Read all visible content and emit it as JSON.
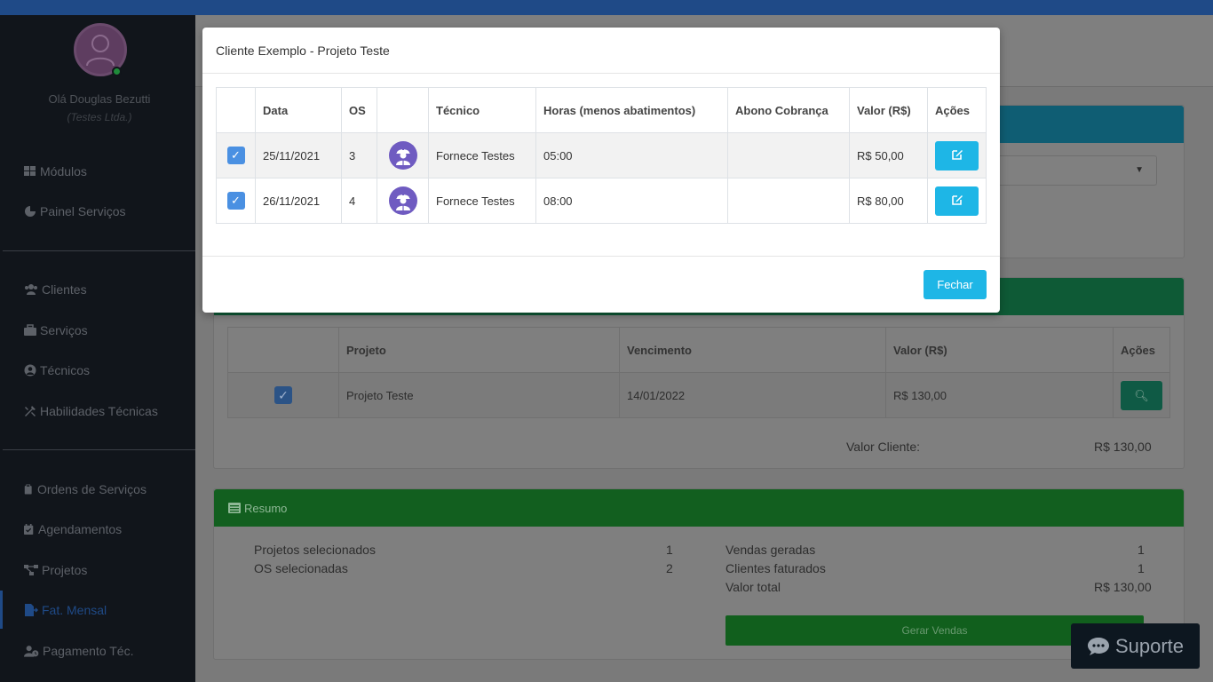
{
  "user": {
    "greeting": "Olá Douglas Bezutti",
    "company": "(Testes Ltda.)"
  },
  "sidebar": {
    "items": [
      {
        "label": "Módulos",
        "icon": "grid-icon"
      },
      {
        "label": "Painel Serviços",
        "icon": "pie-chart-icon"
      },
      {
        "label": "Clientes",
        "icon": "users-icon"
      },
      {
        "label": "Serviços",
        "icon": "briefcase-icon"
      },
      {
        "label": "Técnicos",
        "icon": "user-circle-icon"
      },
      {
        "label": "Habilidades Técnicas",
        "icon": "tools-icon"
      },
      {
        "label": "Ordens de Serviços",
        "icon": "clipboard-icon"
      },
      {
        "label": "Agendamentos",
        "icon": "calendar-check-icon"
      },
      {
        "label": "Projetos",
        "icon": "project-diagram-icon"
      },
      {
        "label": "Fat. Mensal",
        "icon": "file-export-icon",
        "active": true
      },
      {
        "label": "Pagamento Téc.",
        "icon": "user-clock-icon"
      }
    ]
  },
  "projects_table": {
    "headers": [
      "",
      "Projeto",
      "Vencimento",
      "Valor (R$)",
      "Ações"
    ],
    "rows": [
      {
        "projeto": "Projeto Teste",
        "vencimento": "14/01/2022",
        "valor": "R$ 130,00"
      }
    ],
    "valor_cliente_label": "Valor Cliente:",
    "valor_cliente": "R$ 130,00"
  },
  "resumo": {
    "title": "Resumo",
    "projetos_label": "Projetos selecionados",
    "projetos_value": "1",
    "os_label": "OS selecionadas",
    "os_value": "2",
    "vendas_label": "Vendas geradas",
    "vendas_value": "1",
    "clientes_label": "Clientes faturados",
    "clientes_value": "1",
    "total_label": "Valor total",
    "total_value": "R$ 130,00",
    "gerar_label": "Gerar Vendas"
  },
  "support_label": "Suporte",
  "modal": {
    "title": "Cliente Exemplo - Projeto Teste",
    "headers": [
      "",
      "Data",
      "OS",
      "",
      "Técnico",
      "Horas (menos abatimentos)",
      "Abono Cobrança",
      "Valor (R$)",
      "Ações"
    ],
    "rows": [
      {
        "checked": true,
        "data": "25/11/2021",
        "os": "3",
        "tecnico": "Fornece Testes",
        "horas": "05:00",
        "abono": "",
        "valor": "R$ 50,00"
      },
      {
        "checked": true,
        "data": "26/11/2021",
        "os": "4",
        "tecnico": "Fornece Testes",
        "horas": "08:00",
        "abono": "",
        "valor": "R$ 80,00"
      }
    ],
    "close_label": "Fechar"
  },
  "colors": {
    "accent": "#1eb6e6",
    "checkbox": "#4a90e2",
    "avatar": "#6f5bc1"
  }
}
